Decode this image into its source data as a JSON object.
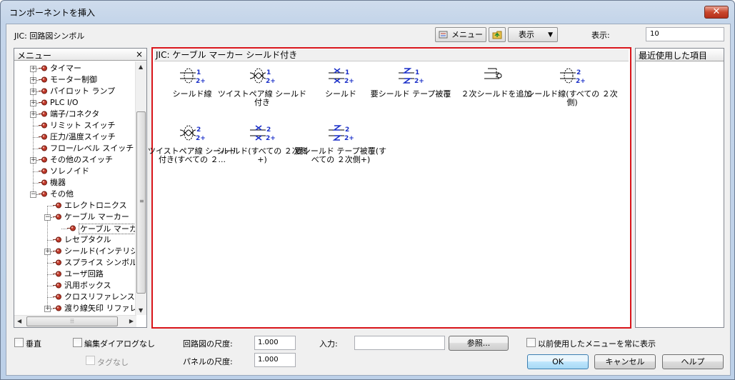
{
  "window": {
    "title": "コンポーネントを挿入",
    "close_glyph": "✕"
  },
  "toolbar": {
    "library": "JIC: 回路図シンボル",
    "menu_button": "メニュー",
    "view_button": "表示",
    "display_label": "表示:",
    "display_value": "10"
  },
  "menu_panel": {
    "title": "メニュー",
    "close_glyph": "×",
    "items": [
      {
        "label": "タイマー"
      },
      {
        "label": "モーター制御"
      },
      {
        "label": "パイロット ランプ"
      },
      {
        "label": "PLC I/O"
      },
      {
        "label": "端子/コネクタ"
      },
      {
        "label": "リミット スイッチ"
      },
      {
        "label": "圧力/温度スイッチ"
      },
      {
        "label": "フロー/レベル スイッチ"
      },
      {
        "label": "その他のスイッチ"
      },
      {
        "label": "ソレノイド"
      },
      {
        "label": "機器"
      },
      {
        "label": "その他"
      },
      {
        "label": "エレクトロニクス"
      },
      {
        "label": "ケーブル マーカー"
      },
      {
        "label": "ケーブル マーカ"
      },
      {
        "label": "レセプタクル"
      },
      {
        "label": "シールド(インテリジェ"
      },
      {
        "label": "スプライス シンボル"
      },
      {
        "label": "ユーザ回路"
      },
      {
        "label": "汎用ボックス"
      },
      {
        "label": "クロスリファレンス シ"
      },
      {
        "label": "渡り線矢印 リファレ"
      }
    ]
  },
  "content_panel": {
    "title": "JIC: ケーブル マーカー シールド付き",
    "symbols": [
      {
        "caption": "シールド線"
      },
      {
        "caption": "ツイストペア線 シールド付き"
      },
      {
        "caption": "シールド"
      },
      {
        "caption": "要シールド テープ被覆"
      },
      {
        "caption": "２次シールドを追加"
      },
      {
        "caption": "シールド線(すべての ２次側)"
      },
      {
        "caption": "ツイストペア線 シールド付き(すべての ２..."
      },
      {
        "caption": "シールド(すべての ２次側+)"
      },
      {
        "caption": "要シールド テープ被覆(すべての ２次側+)"
      }
    ],
    "labels": {
      "one": "1",
      "two": "2",
      "twoplus": "2+"
    }
  },
  "recent_panel": {
    "title": "最近使用した項目"
  },
  "bottom": {
    "vertical": "垂直",
    "no_edit_dialog": "編集ダイアログなし",
    "no_tag": "タグなし",
    "schematic_scale_label": "回路図の尺度:",
    "schematic_scale_value": "1.000",
    "panel_scale_label": "パネルの尺度:",
    "panel_scale_value": "1.000",
    "input_label": "入力:",
    "input_value": "",
    "browse_button": "参照...",
    "show_previous_menu": "以前使用したメニューを常に表示",
    "ok": "OK",
    "cancel": "キャンセル",
    "help": "ヘルプ"
  },
  "colors": {
    "accent_border": "#d9151b",
    "symbol_blue": "#1a2fc8"
  }
}
